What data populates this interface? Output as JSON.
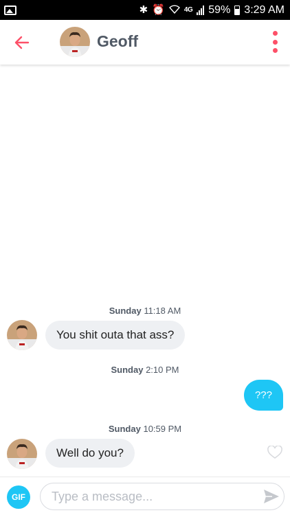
{
  "status_bar": {
    "network": "4G",
    "battery": "59%",
    "time": "3:29 AM",
    "icons": [
      "gallery-icon",
      "bluetooth-icon",
      "alarm-icon",
      "wifi-icon",
      "signal-icon",
      "battery-icon"
    ]
  },
  "header": {
    "name": "Geoff",
    "back_icon": "arrow-left-icon",
    "menu_icon": "more-vertical-icon"
  },
  "messages": [
    {
      "type": "timestamp",
      "day": "Sunday",
      "time": "11:18 AM"
    },
    {
      "type": "incoming",
      "text": "You shit outa that ass?"
    },
    {
      "type": "timestamp",
      "day": "Sunday",
      "time": "2:10 PM"
    },
    {
      "type": "outgoing",
      "text": "???"
    },
    {
      "type": "timestamp",
      "day": "Sunday",
      "time": "10:59 PM"
    },
    {
      "type": "incoming",
      "text": "Well do you?"
    }
  ],
  "composer": {
    "gif_label": "GIF",
    "placeholder": "Type a message...",
    "send_icon": "send-icon"
  },
  "colors": {
    "accent_red": "#fd5068",
    "bubble_out": "#1ec6f5",
    "bubble_in": "#eef0f3"
  }
}
